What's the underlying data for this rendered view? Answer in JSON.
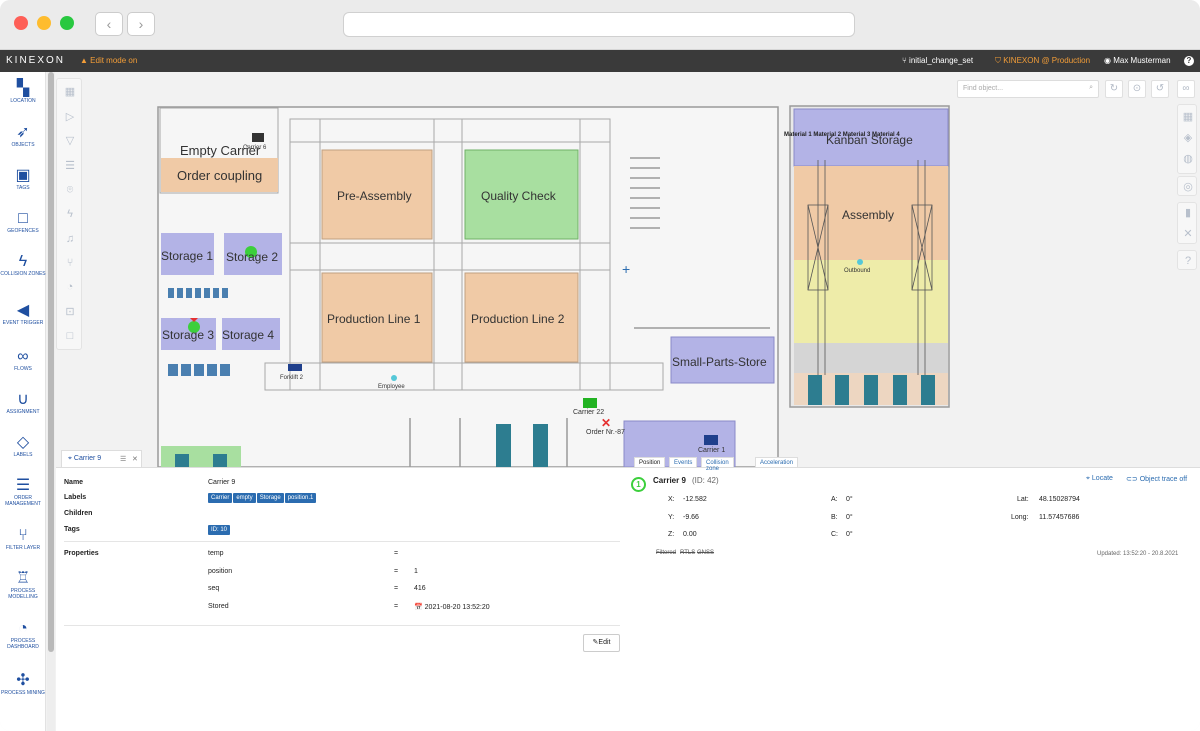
{
  "topbar": {
    "brand": "KINEXON",
    "edit_mode": "Edit mode on",
    "change_set": "initial_change_set",
    "production": "KINEXON @ Production",
    "user": "Max Musterman",
    "help": "?"
  },
  "sidebar": {
    "items": [
      {
        "label": "LOCATION",
        "icon": "map-icon"
      },
      {
        "label": "OBJECTS",
        "icon": "rocket-icon"
      },
      {
        "label": "TAGS",
        "icon": "chip-icon"
      },
      {
        "label": "GEOFENCES",
        "icon": "square-icon"
      },
      {
        "label": "COLLISION ZONES",
        "icon": "bolt-icon"
      },
      {
        "label": "EVENT TRIGGER",
        "icon": "megaphone-icon"
      },
      {
        "label": "FLOWS",
        "icon": "link-icon"
      },
      {
        "label": "ASSIGNMENT",
        "icon": "magnet-icon"
      },
      {
        "label": "LABELS",
        "icon": "tag-icon"
      },
      {
        "label": "ORDER MANAGEMENT",
        "icon": "list-icon"
      },
      {
        "label": "FILTER LAYER",
        "icon": "branch-icon"
      },
      {
        "label": "PROCESS MODELLING",
        "icon": "hierarchy-icon"
      },
      {
        "label": "PROCESS DASHBOARD",
        "icon": "gauge-icon"
      },
      {
        "label": "PROCESS MINING",
        "icon": "puzzle-icon"
      }
    ]
  },
  "map": {
    "search_placeholder": "Find object...",
    "zones": {
      "empty_carrier": "Empty Carrier",
      "order_coupling": "Order coupling",
      "pre_assembly": "Pre-Assembly",
      "quality_check": "Quality Check",
      "production_line_1": "Production Line 1",
      "production_line_2": "Production Line 2",
      "storage_1": "Storage 1",
      "storage_2": "Storage 2",
      "storage_3": "Storage 3",
      "storage_4": "Storage 4",
      "small_parts_store": "Small-Parts-Store",
      "kanban_storage": "Kanban Storage",
      "assembly": "Assembly",
      "outbound": "Outbound"
    },
    "objects": {
      "carrier_6": "Carrier 6",
      "forklift_2": "Forklift 2",
      "employee": "Employee",
      "carrier_22": "Carrier 22",
      "order_nr": "Order Nr.-87",
      "carrier_1": "Carrier 1",
      "materials": "Material 1 Material 2 Material 3 Material 4",
      "marker_1": "1",
      "marker_2": "2"
    },
    "colors": {
      "blue_zone": "#b3b3e6",
      "orange_zone": "#f0caa6",
      "green_zone": "#a8dfa0",
      "yellow_zone": "#eeeca9"
    }
  },
  "detail": {
    "tab_title": "Carrier 9",
    "name_label": "Name",
    "name_value": "Carrier 9",
    "labels_label": "Labels",
    "labels": [
      "Carrier",
      "empty",
      "Storage",
      "position.1"
    ],
    "children_label": "Children",
    "tags_label": "Tags",
    "tags": [
      "ID: 10"
    ],
    "properties_label": "Properties",
    "properties": [
      {
        "key": "temp",
        "eq": "=",
        "value": ""
      },
      {
        "key": "position",
        "eq": "=",
        "value": "1"
      },
      {
        "key": "seq",
        "eq": "=",
        "value": "416"
      },
      {
        "key": "Stored",
        "eq": "=",
        "value": "2021-08-20 13:52:20"
      }
    ],
    "edit_label": "Edit"
  },
  "position": {
    "tabs": [
      "Position",
      "Events",
      "Collision zone",
      "Acceleration"
    ],
    "marker": "1",
    "title": "Carrier 9",
    "id_text": "(ID: 42)",
    "locate": "Locate",
    "trace": "Object trace off",
    "x_label": "X:",
    "x_value": "-12.582",
    "y_label": "Y:",
    "y_value": "-9.66",
    "z_label": "Z:",
    "z_value": "0.00",
    "a_label": "A:",
    "a_value": "0°",
    "b_label": "B:",
    "b_value": "0°",
    "c_label": "C:",
    "c_value": "0°",
    "lat_label": "Lat:",
    "lat_value": "48.15028794",
    "long_label": "Long:",
    "long_value": "11.57457686",
    "filtered": "Filtered",
    "rtls": "RTLS",
    "gnss": "GNSS",
    "updated": "Updated: 13:52:20 - 20.8.2021"
  }
}
